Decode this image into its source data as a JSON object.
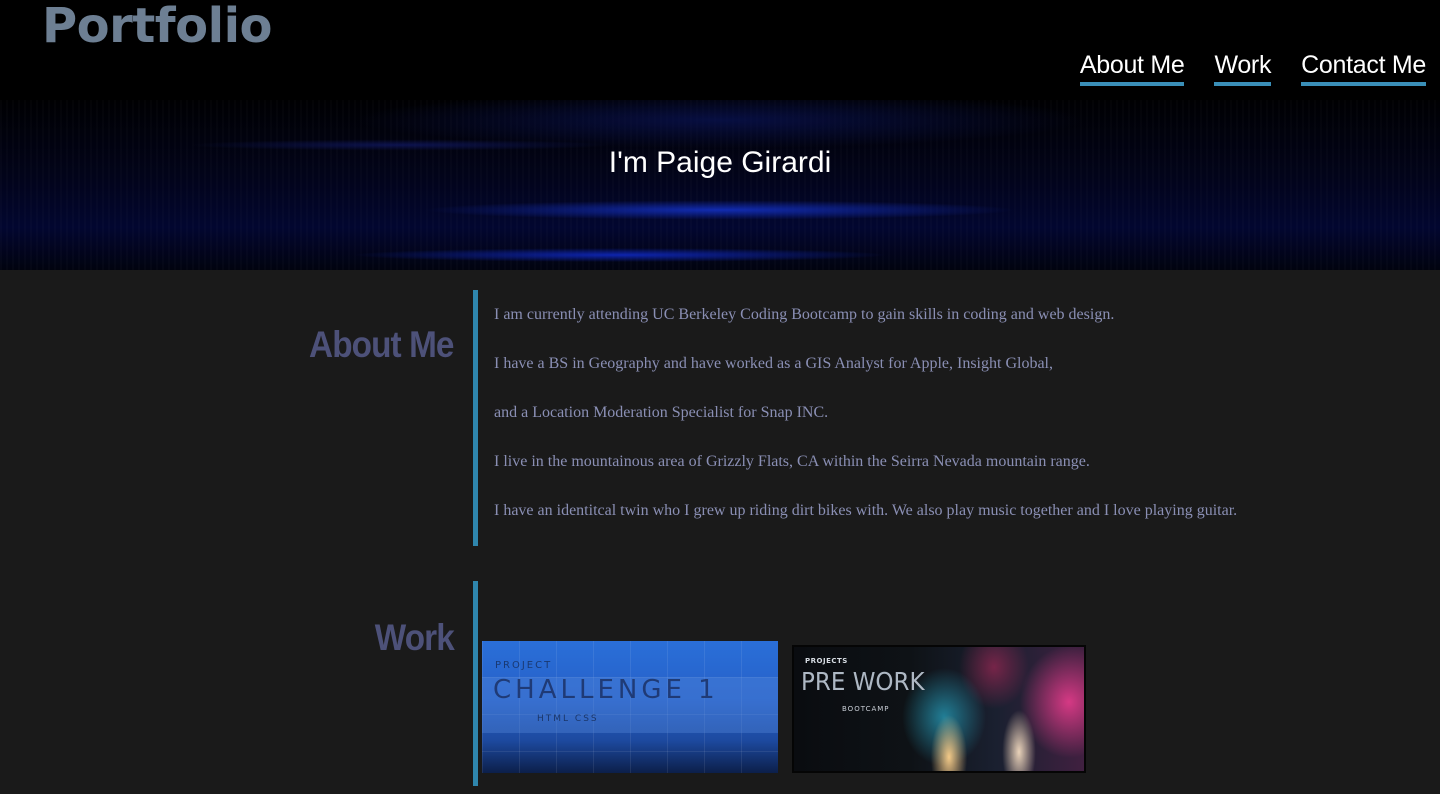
{
  "header": {
    "logo": "Portfolio",
    "nav": [
      {
        "label": "About Me"
      },
      {
        "label": "Work"
      },
      {
        "label": "Contact Me"
      }
    ]
  },
  "hero": {
    "title": "I'm Paige Girardi"
  },
  "about": {
    "heading": "About Me",
    "paragraphs": [
      "I am currently attending UC Berkeley Coding Bootcamp to gain skills in coding and web design.",
      "I have a BS in Geography and have worked as a GIS Analyst for Apple, Insight Global,",
      "and a Location Moderation Specialist for Snap INC.",
      "I live in the mountainous area of Grizzly Flats, CA within the Seirra Nevada mountain range.",
      "I have an identitcal twin who I grew up riding dirt bikes with. We also play music together and I love playing guitar."
    ]
  },
  "work": {
    "heading": "Work",
    "projects": [
      {
        "small": "PROJECT",
        "big": "CHALLENGE 1",
        "sub": "HTML CSS"
      },
      {
        "small": "PROJECTS",
        "big": "PRE WORK",
        "sub": "BOOTCAMP"
      }
    ]
  },
  "colors": {
    "accent": "#2f86ad",
    "heading": "#4d5179",
    "body_text": "#8a8fb4",
    "logo": "#6d7f93",
    "background": "#1a1a1a"
  }
}
